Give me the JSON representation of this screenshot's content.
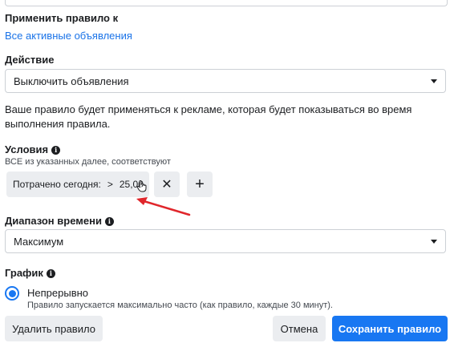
{
  "apply_section": {
    "title": "Применить правило к",
    "link": "Все активные объявления"
  },
  "action_section": {
    "title": "Действие",
    "selected": "Выключить объявления"
  },
  "note": "Ваше правило будет применяться к рекламе, которая будет показываться во время выполнения правила.",
  "conditions": {
    "title": "Условия",
    "subtitle": "ВСЕ из указанных далее, соответствуют",
    "chip": {
      "metric": "Потрачено сегодня:",
      "operator": ">",
      "value": "25,00"
    },
    "remove_icon": "close-icon",
    "add_icon": "plus-icon",
    "remove_label": "✕",
    "add_label": "+"
  },
  "time_range": {
    "title": "Диапазон времени",
    "selected": "Максимум"
  },
  "schedule": {
    "title": "График",
    "option_label": "Непрерывно",
    "option_hint": "Правило запускается максимально часто (как правило, каждые 30 минут)."
  },
  "footer": {
    "delete_label": "Удалить правило",
    "cancel_label": "Отмена",
    "save_label": "Сохранить правило"
  },
  "colors": {
    "accent": "#1877f2",
    "link": "#1a73e8",
    "annotation_arrow": "#e0262b"
  }
}
